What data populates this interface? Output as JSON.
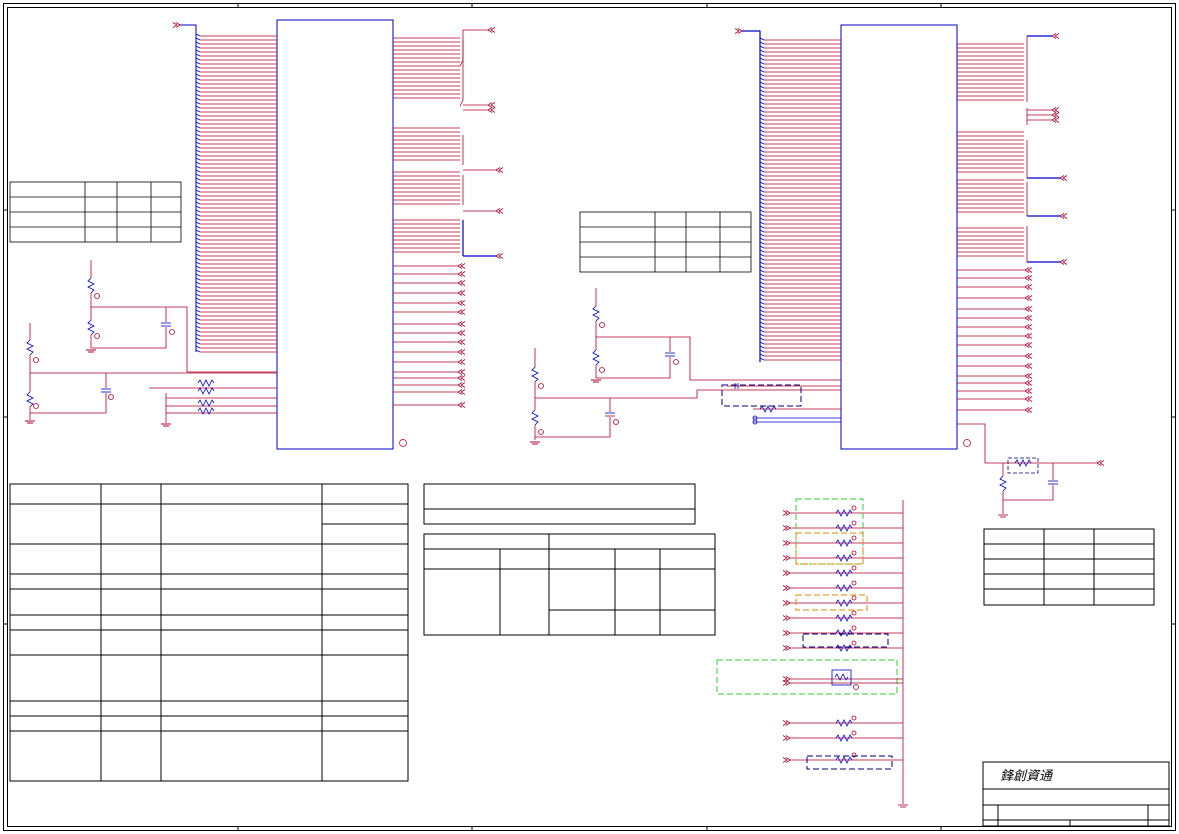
{
  "title_block": {
    "company_name": "鋒創資通"
  },
  "colors": {
    "net": "#b2002a",
    "bus": "#0000c8",
    "frame": "#000000",
    "zone_green": "#33cc33",
    "zone_orange": "#e08a00",
    "zone_navy": "#000080"
  },
  "icons": [
    "ground-symbol",
    "capacitor-symbol",
    "resistor-symbol",
    "off-page-connector"
  ]
}
